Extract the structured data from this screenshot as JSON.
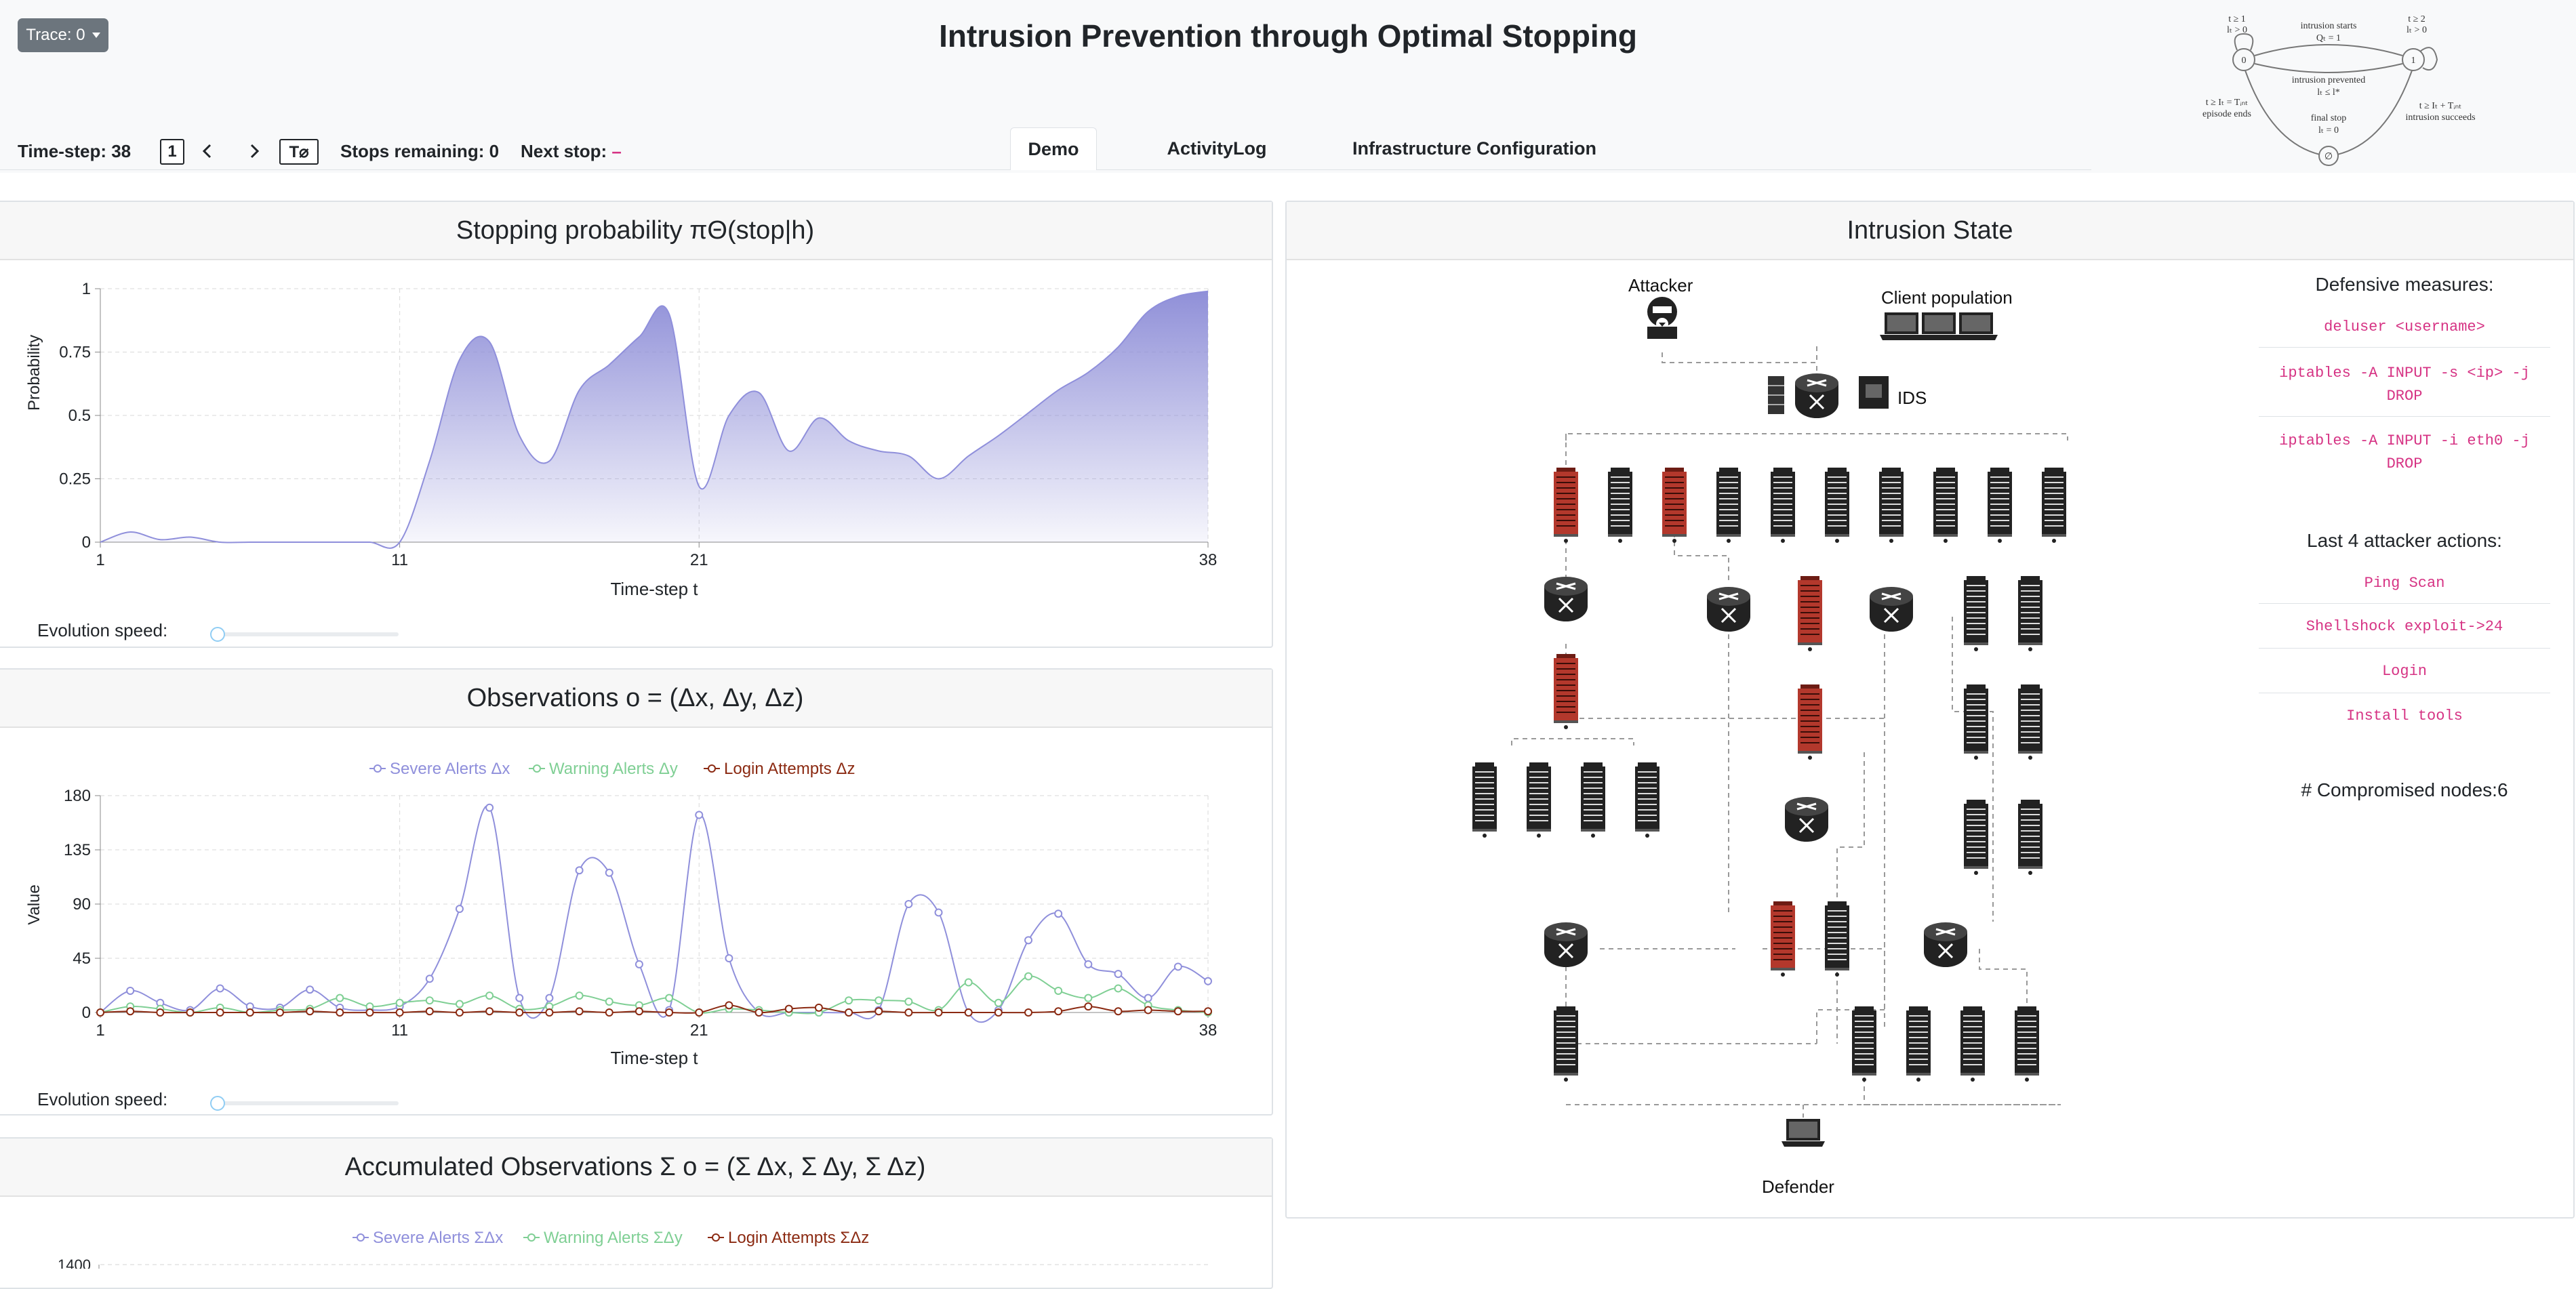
{
  "header": {
    "trace_button": "Trace: 0",
    "title": "Intrusion Prevention through Optimal Stopping",
    "time_step": "Time-step: 38",
    "step_box": "1",
    "t_button": "T⌀",
    "stops_remaining": "Stops remaining: 0",
    "next_stop": "Next stop:",
    "next_stop_value": "–"
  },
  "tabs": [
    {
      "label": "Demo",
      "active": true
    },
    {
      "label": "ActivityLog",
      "active": false
    },
    {
      "label": "Infrastructure Configuration",
      "active": false
    }
  ],
  "mini_diagram": {
    "state_0": "0",
    "state_1": "1",
    "state_end": "∅",
    "label_t1": "t ≥ 1",
    "label_lt0": "lₜ > 0",
    "label_t2": "t ≥ 2",
    "label_lt0b": "lₜ > 0",
    "label_intrusion_starts": "intrusion starts",
    "label_qt": "Qₜ = 1",
    "label_intrusion_prevented": "intrusion prevented",
    "label_lt_le": "lₜ ≤ l*",
    "label_final_stop": "final stop",
    "label_lt_eq0": "lₜ = 0",
    "label_episode_ends": "episode ends",
    "label_t_tint": "t ≥ Iₜ = Tᵢₙₜ",
    "label_t_tint2": "t ≥ Iₜ + Tᵢₙₜ",
    "label_intrusion_succeeds": "intrusion succeeds"
  },
  "colors": {
    "severe": "#8f8fdb",
    "warning": "#7fcf94",
    "login": "#8b2a12",
    "compromised": "#b3382c",
    "command": "#d63384"
  },
  "stopping_panel": {
    "title": "Stopping probability πΘ(stop|h)",
    "speed_label": "Evolution speed:",
    "speed_value": 0.0
  },
  "observations_panel": {
    "title": "Observations o = (Δx, Δy, Δz)",
    "speed_label": "Evolution speed:",
    "speed_value": 0.0
  },
  "accumulated_panel": {
    "title": "Accumulated Observations Σ o = (Σ Δx, Σ Δy, Σ Δz)"
  },
  "chart_data": [
    {
      "type": "area",
      "ylabel": "Probability",
      "xlabel": "Time-step t",
      "xlim": [
        1,
        38
      ],
      "ylim": [
        0,
        1
      ],
      "x_ticks": [
        "1",
        "11",
        "21",
        "38"
      ],
      "y_ticks": [
        "0",
        "0.25",
        "0.5",
        "0.75",
        "1"
      ],
      "x": [
        1,
        2,
        3,
        4,
        5,
        6,
        7,
        8,
        9,
        10,
        11,
        12,
        13,
        14,
        15,
        16,
        17,
        18,
        19,
        20,
        21,
        22,
        23,
        24,
        25,
        26,
        27,
        28,
        29,
        30,
        31,
        32,
        33,
        34,
        35,
        36,
        37,
        38
      ],
      "series": [
        {
          "values": [
            0.0,
            0.04,
            0.01,
            0.02,
            0.0,
            0.0,
            0.0,
            0.0,
            0.0,
            0.0,
            0.0,
            0.32,
            0.72,
            0.79,
            0.42,
            0.32,
            0.6,
            0.7,
            0.81,
            0.9,
            0.22,
            0.5,
            0.59,
            0.36,
            0.49,
            0.4,
            0.36,
            0.34,
            0.25,
            0.34,
            0.42,
            0.51,
            0.6,
            0.67,
            0.77,
            0.91,
            0.97,
            0.99
          ]
        }
      ]
    },
    {
      "type": "line",
      "ylabel": "Value",
      "xlabel": "Time-step t",
      "xlim": [
        1,
        38
      ],
      "ylim": [
        0,
        180
      ],
      "x_ticks": [
        "1",
        "11",
        "21",
        "38"
      ],
      "y_ticks": [
        "0",
        "45",
        "90",
        "135",
        "180"
      ],
      "x": [
        1,
        2,
        3,
        4,
        5,
        6,
        7,
        8,
        9,
        10,
        11,
        12,
        13,
        14,
        15,
        16,
        17,
        18,
        19,
        20,
        21,
        22,
        23,
        24,
        25,
        26,
        27,
        28,
        29,
        30,
        31,
        32,
        33,
        34,
        35,
        36,
        37,
        38
      ],
      "series": [
        {
          "name": "Severe Alerts Δx",
          "values": [
            0,
            18,
            8,
            2,
            20,
            5,
            4,
            19,
            4,
            2,
            5,
            28,
            86,
            170,
            12,
            12,
            118,
            116,
            40,
            2,
            164,
            45,
            0,
            0,
            0,
            0,
            2,
            90,
            83,
            0,
            2,
            60,
            82,
            40,
            32,
            12,
            38,
            26
          ]
        },
        {
          "name": "Warning Alerts Δy",
          "values": [
            0,
            5,
            3,
            0,
            4,
            0,
            2,
            3,
            12,
            5,
            8,
            10,
            7,
            14,
            3,
            5,
            14,
            9,
            6,
            12,
            0,
            3,
            2,
            0,
            0,
            10,
            10,
            9,
            2,
            25,
            8,
            30,
            18,
            12,
            20,
            6,
            2
          ]
        },
        {
          "name": "Login Attempts Δz",
          "values": [
            0,
            1,
            0,
            0,
            0,
            0,
            0,
            1,
            0,
            0,
            0,
            1,
            0,
            1,
            0,
            0,
            1,
            0,
            1,
            0,
            0,
            6,
            0,
            3,
            4,
            0,
            1,
            0,
            0,
            0,
            0,
            0,
            1,
            5,
            1,
            2,
            1,
            1
          ]
        }
      ]
    },
    {
      "type": "line",
      "ylim": [
        0,
        1400
      ],
      "y_ticks": [
        "1400"
      ],
      "series": [
        {
          "name": "Severe Alerts ΣΔx"
        },
        {
          "name": "Warning Alerts ΣΔy"
        },
        {
          "name": "Login Attempts ΣΔz"
        }
      ]
    }
  ],
  "intrusion_panel": {
    "title": "Intrusion State",
    "attacker_label": "Attacker",
    "client_label": "Client population",
    "ids_label": "IDS",
    "defender_label": "Defender",
    "defensive_title": "Defensive measures:",
    "defensive_measures": [
      "deluser <username>",
      "iptables -A INPUT -s <ip> -j DROP",
      "iptables -A INPUT -i eth0 -j DROP"
    ],
    "attacker_title": "Last 4 attacker actions:",
    "attacker_actions": [
      "Ping Scan",
      "Shellshock exploit->24",
      "Login",
      "Install tools"
    ],
    "compromised": "# Compromised nodes:6"
  }
}
